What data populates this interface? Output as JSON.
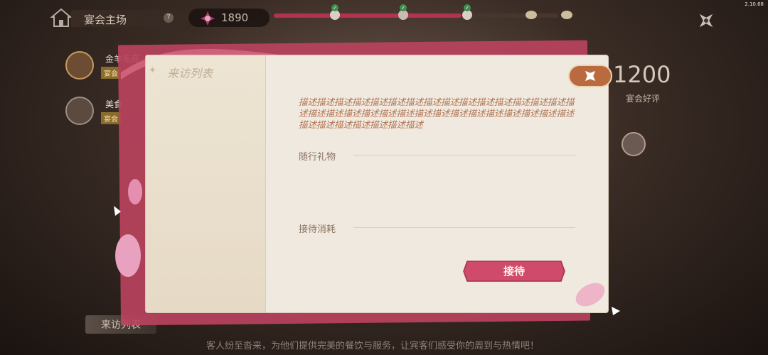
{
  "version": "2.10.68",
  "topbar": {
    "scene_title": "宴会主场",
    "help_label": "?",
    "score": "1890",
    "progress": 0.66,
    "close_label": "close"
  },
  "left_tasks": [
    {
      "name": "金羊毛商",
      "tag": "宴会"
    },
    {
      "name": "美食",
      "tag": "宴会"
    }
  ],
  "right_panel": {
    "big_score": "1200",
    "score_label": "宴会好评"
  },
  "modal": {
    "title": "来访列表",
    "description": "描述描述描述描述描述描述描述描述描述描述描述描述描述描述描述描述描述描述描述描述描述描述描述描述描述描述描述描述描述描述描述描述描述描述描述描述描述描述",
    "gift_label": "随行礼物",
    "cost_label": "接待消耗",
    "accept_button": "接待"
  },
  "bottom": {
    "tab_label": "来访列表",
    "hint": "客人纷至沓来，为他们提供完美的餐饮与服务，让宾客们感受你的周到与热情吧！"
  },
  "colors": {
    "accent_red": "#b3324e",
    "button_red": "#d0486a",
    "paper": "#efe9df",
    "desc_text": "#b47553"
  },
  "icons": [
    "home-icon",
    "help-icon",
    "gem-icon",
    "close-shuriken-icon",
    "gift-icon",
    "sparkle-icon"
  ]
}
